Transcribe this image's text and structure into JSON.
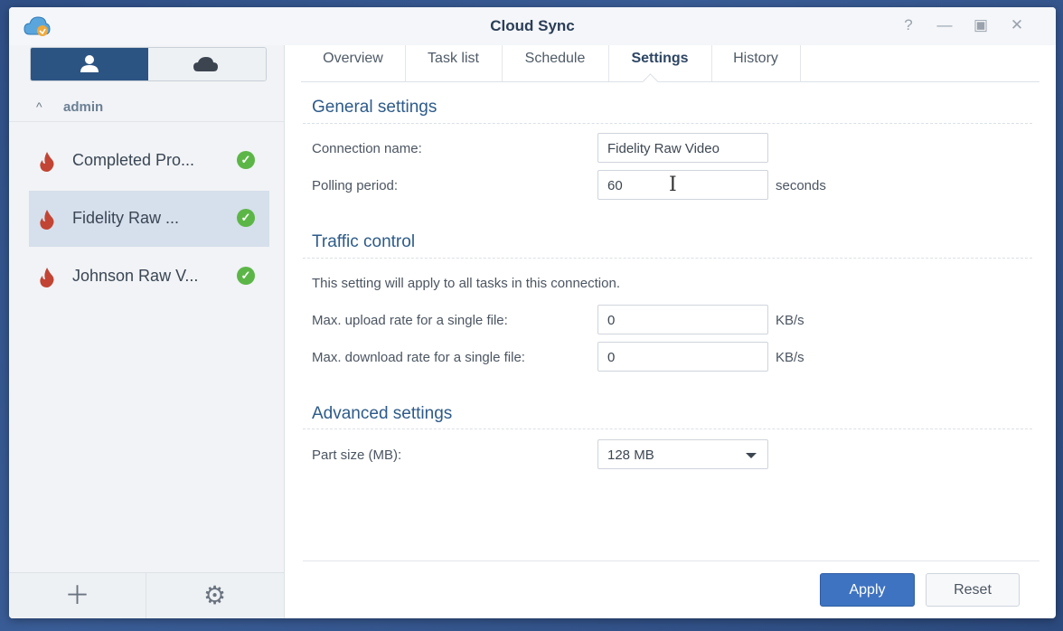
{
  "window": {
    "title": "Cloud Sync"
  },
  "sidebar": {
    "group": "admin",
    "connections": [
      {
        "name": "Completed Pro...",
        "status": "ok"
      },
      {
        "name": "Fidelity Raw ...",
        "status": "ok"
      },
      {
        "name": "Johnson Raw V...",
        "status": "ok"
      }
    ]
  },
  "tabs": [
    "Overview",
    "Task list",
    "Schedule",
    "Settings",
    "History"
  ],
  "active_tab": "Settings",
  "general": {
    "title": "General settings",
    "connection_name_label": "Connection name:",
    "connection_name_value": "Fidelity Raw Video",
    "polling_label": "Polling period:",
    "polling_value": "60",
    "polling_unit": "seconds"
  },
  "traffic": {
    "title": "Traffic control",
    "note": "This setting will apply to all tasks in this connection.",
    "upload_label": "Max. upload rate for a single file:",
    "upload_value": "0",
    "upload_unit": "KB/s",
    "download_label": "Max. download rate for a single file:",
    "download_value": "0",
    "download_unit": "KB/s"
  },
  "advanced": {
    "title": "Advanced settings",
    "part_size_label": "Part size (MB):",
    "part_size_value": "128 MB"
  },
  "buttons": {
    "apply": "Apply",
    "reset": "Reset"
  },
  "colors": {
    "accent": "#3e73c2",
    "selected": "#d6dfec",
    "ok": "#5cb647",
    "brand_dark": "#2c5483"
  }
}
